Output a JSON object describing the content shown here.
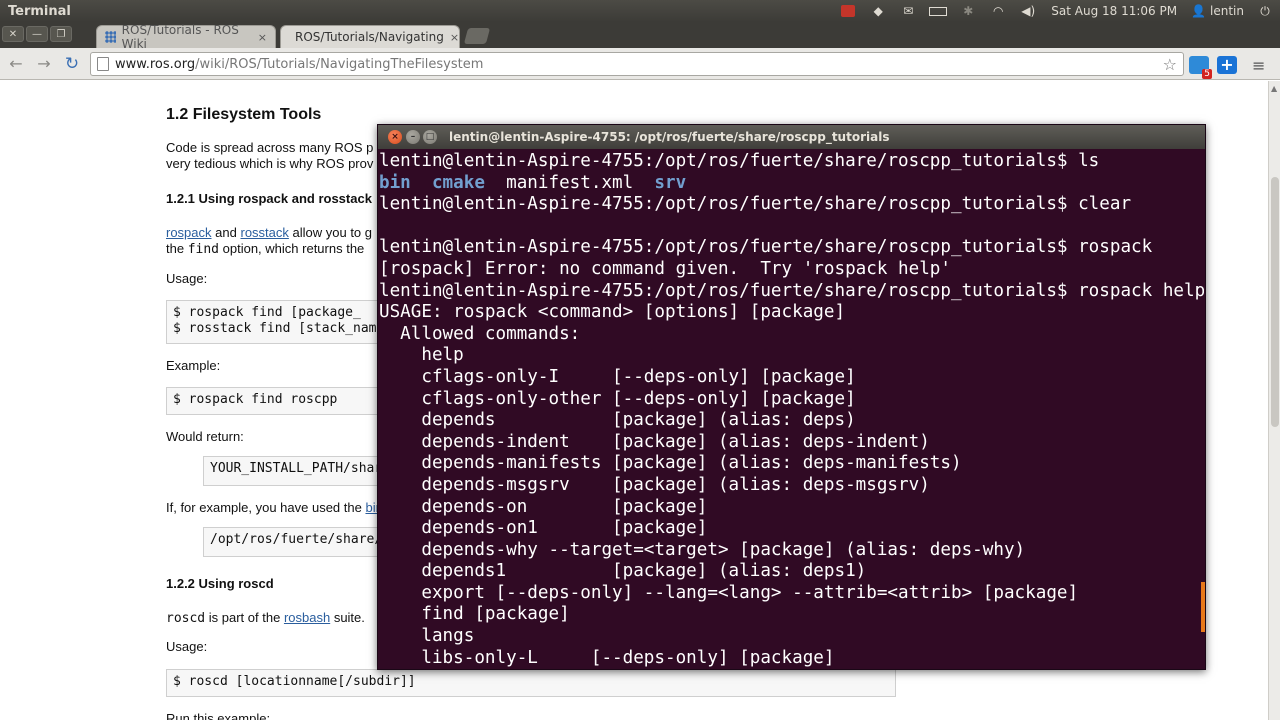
{
  "panel": {
    "app_title": "Terminal",
    "clock": "Sat Aug 18 11:06 PM",
    "user": "lentin",
    "indicators": [
      "record-icon",
      "dropbox-icon",
      "mail-icon",
      "battery-icon",
      "bluetooth-icon",
      "wifi-icon",
      "volume-icon",
      "user-icon",
      "power-icon"
    ]
  },
  "browser": {
    "window_buttons": [
      "✕",
      "—",
      "❐"
    ],
    "tabs": [
      {
        "label": "ROS/Tutorials - ROS Wiki",
        "close": "×"
      },
      {
        "label": "ROS/Tutorials/Navigating",
        "close": "×"
      }
    ],
    "url_host": "www.ros.org",
    "url_path": "/wiki/ROS/Tutorials/NavigatingTheFilesystem",
    "extension_badge": "5"
  },
  "wiki": {
    "heading": "1.2 Filesystem Tools",
    "intro_line1": "Code is spread across many ROS p",
    "intro_line2": "very tedious which is why ROS prov",
    "sub1": "1.2.1 Using rospack and rosstack",
    "rospack_link": "rospack",
    "and_word": "and",
    "rosstack_link": "rosstack",
    "allow_text": "allow you to g",
    "option_pre": "the",
    "option_code": "find",
    "option_post": "option, which returns the",
    "usage_label": "Usage:",
    "usage_code1": "$ rospack find [package_",
    "usage_code2": "$ rosstack find [stack_name",
    "example_label": "Example:",
    "example_code": "$ rospack find roscpp",
    "would_return": "Would return:",
    "return_code": "YOUR_INSTALL_PATH/share/r",
    "if_example_pre": "If, for example, you have used the",
    "if_example_link": "binary i",
    "fuerte_code": "/opt/ros/fuerte/share/ros",
    "sub2": "1.2.2 Using roscd",
    "roscd_code": "roscd",
    "roscd_text_pre": "is part of the",
    "rosbash_link": "rosbash",
    "roscd_text_post": "suite.",
    "usage_label2": "Usage:",
    "roscd_usage": "$ roscd [locationname[/subdir]]",
    "run_example": "Run this example:"
  },
  "terminal": {
    "title": "lentin@lentin-Aspire-4755: /opt/ros/fuerte/share/roscpp_tutorials",
    "lines": [
      {
        "text": "lentin@lentin-Aspire-4755:/opt/ros/fuerte/share/roscpp_tutorials$ ls"
      },
      {
        "parts": [
          {
            "text": "bin",
            "cls": "blue"
          },
          {
            "text": "  "
          },
          {
            "text": "cmake",
            "cls": "blue"
          },
          {
            "text": "  manifest.xml  "
          },
          {
            "text": "srv",
            "cls": "blue"
          }
        ]
      },
      {
        "text": "lentin@lentin-Aspire-4755:/opt/ros/fuerte/share/roscpp_tutorials$ clear"
      },
      {
        "text": ""
      },
      {
        "text": "lentin@lentin-Aspire-4755:/opt/ros/fuerte/share/roscpp_tutorials$ rospack"
      },
      {
        "text": "[rospack] Error: no command given.  Try 'rospack help'"
      },
      {
        "text": "lentin@lentin-Aspire-4755:/opt/ros/fuerte/share/roscpp_tutorials$ rospack help"
      },
      {
        "text": "USAGE: rospack <command> [options] [package]"
      },
      {
        "text": "  Allowed commands:"
      },
      {
        "text": "    help"
      },
      {
        "text": "    cflags-only-I     [--deps-only] [package]"
      },
      {
        "text": "    cflags-only-other [--deps-only] [package]"
      },
      {
        "text": "    depends           [package] (alias: deps)"
      },
      {
        "text": "    depends-indent    [package] (alias: deps-indent)"
      },
      {
        "text": "    depends-manifests [package] (alias: deps-manifests)"
      },
      {
        "text": "    depends-msgsrv    [package] (alias: deps-msgsrv)"
      },
      {
        "text": "    depends-on        [package]"
      },
      {
        "text": "    depends-on1       [package]"
      },
      {
        "text": "    depends-why --target=<target> [package] (alias: deps-why)"
      },
      {
        "text": "    depends1          [package] (alias: deps1)"
      },
      {
        "text": "    export [--deps-only] --lang=<lang> --attrib=<attrib> [package]"
      },
      {
        "text": "    find [package]"
      },
      {
        "text": "    langs"
      },
      {
        "text": "    libs-only-L     [--deps-only] [package]"
      }
    ]
  },
  "colors": {
    "terminal_bg": "#300a24",
    "terminal_fg": "#ffffff",
    "dir_blue": "#729fcf",
    "link": "#2a5e9e",
    "panel_bg": "#3c3b37"
  }
}
